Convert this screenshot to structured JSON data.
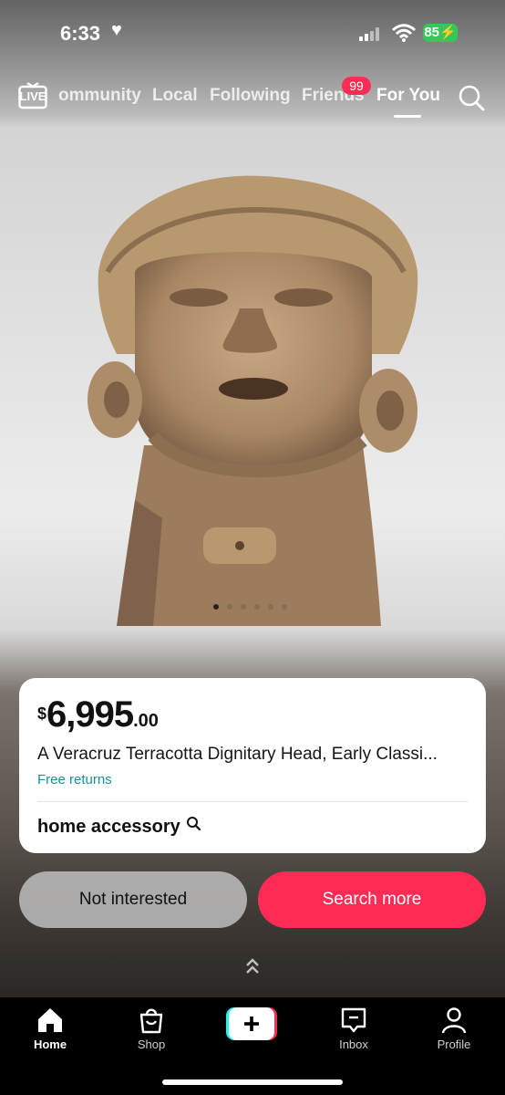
{
  "status": {
    "time": "6:33",
    "battery": "85"
  },
  "nav": {
    "live": "LIVE",
    "tabs": [
      "ommunity",
      "Local",
      "Following",
      "Friends",
      "For You"
    ],
    "active_tab": "For You",
    "friends_badge": "99"
  },
  "carousel": {
    "count": 6,
    "active": 0
  },
  "product": {
    "currency": "$",
    "price_whole": "6,995",
    "price_cents": ".00",
    "title": "A Veracruz Terracotta Dignitary Head, Early Classi...",
    "returns": "Free returns",
    "keyword": "home accessory"
  },
  "actions": {
    "not_interested": "Not interested",
    "search_more": "Search more"
  },
  "tabbar": {
    "home": "Home",
    "shop": "Shop",
    "inbox": "Inbox",
    "profile": "Profile"
  },
  "colors": {
    "accent": "#fe2c55",
    "link": "#1e8ca0",
    "battery": "#35c759"
  }
}
